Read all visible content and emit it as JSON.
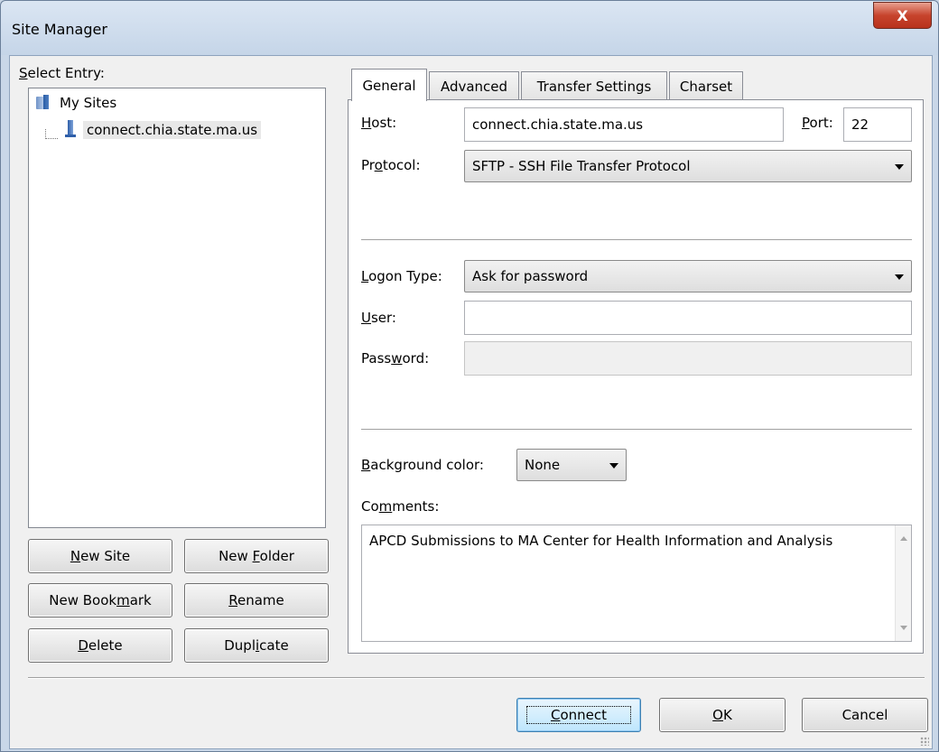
{
  "window": {
    "title": "Site Manager",
    "close_glyph": "X"
  },
  "left": {
    "select_entry_label": "Select Entry:",
    "tree": {
      "root": "My Sites",
      "site": "connect.chia.state.ma.us"
    },
    "buttons": {
      "new_site": "New Site",
      "new_folder": "New Folder",
      "new_bookmark": "New Bookmark",
      "rename": "Rename",
      "delete": "Delete",
      "duplicate": "Duplicate"
    }
  },
  "tabs": [
    "General",
    "Advanced",
    "Transfer Settings",
    "Charset"
  ],
  "general": {
    "host_label": "Host:",
    "host_value": "connect.chia.state.ma.us",
    "port_label": "Port:",
    "port_value": "22",
    "protocol_label": "Protocol:",
    "protocol_value": "SFTP - SSH File Transfer Protocol",
    "logon_type_label": "Logon Type:",
    "logon_type_value": "Ask for password",
    "user_label": "User:",
    "user_value": "",
    "password_label": "Password:",
    "password_value": "",
    "background_color_label": "Background color:",
    "background_color_value": "None",
    "comments_label": "Comments:",
    "comments_value": "APCD Submissions to MA Center for Health Information and Analysis"
  },
  "footer": {
    "connect": "Connect",
    "ok": "OK",
    "cancel": "Cancel"
  }
}
